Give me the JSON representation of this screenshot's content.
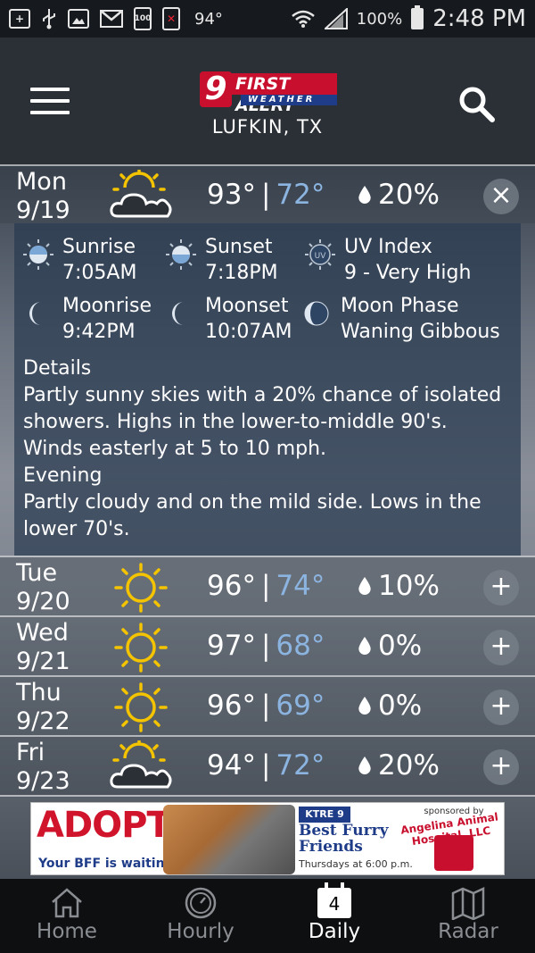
{
  "status_bar": {
    "temperature": "94°",
    "battery": "100%",
    "time": "2:48 PM",
    "notification_icons": [
      "plus-icon",
      "usb-icon",
      "image-icon",
      "gmail-icon",
      "battery-100-icon",
      "close-icon"
    ]
  },
  "header": {
    "logo_number": "9",
    "logo_text": "FIRST ALERT",
    "logo_sub": "WEATHER",
    "location": "LUFKIN, TX"
  },
  "forecast": [
    {
      "day": "Mon",
      "date": "9/19",
      "icon": "partly-cloudy-icon",
      "high": "93°",
      "low": "72°",
      "precip": "20%",
      "toggle": "×"
    },
    {
      "day": "Tue",
      "date": "9/20",
      "icon": "sunny-icon",
      "high": "96°",
      "low": "74°",
      "precip": "10%",
      "toggle": "+"
    },
    {
      "day": "Wed",
      "date": "9/21",
      "icon": "sunny-icon",
      "high": "97°",
      "low": "68°",
      "precip": "0%",
      "toggle": "+"
    },
    {
      "day": "Thu",
      "date": "9/22",
      "icon": "sunny-icon",
      "high": "96°",
      "low": "69°",
      "precip": "0%",
      "toggle": "+"
    },
    {
      "day": "Fri",
      "date": "9/23",
      "icon": "partly-cloudy-icon",
      "high": "94°",
      "low": "72°",
      "precip": "20%",
      "toggle": "+"
    }
  ],
  "details": {
    "sunrise_label": "Sunrise",
    "sunrise_value": "7:05AM",
    "sunset_label": "Sunset",
    "sunset_value": "7:18PM",
    "uv_label": "UV Index",
    "uv_value": "9 - Very High",
    "uv_badge": "UV",
    "moonrise_label": "Moonrise",
    "moonrise_value": "9:42PM",
    "moonset_label": "Moonset",
    "moonset_value": "10:07AM",
    "moonphase_label": "Moon Phase",
    "moonphase_value": "Waning Gibbous",
    "details_heading": "Details",
    "details_text": "Partly sunny skies with a 20% chance of isolated showers.  Highs in the lower-to-middle 90's. Winds easterly at 5 to 10 mph.",
    "evening_heading": "Evening",
    "evening_text": "Partly cloudy and on the mild side.  Lows in the lower 70's."
  },
  "ad": {
    "headline": "ADOPT!",
    "tagline": "Your BFF is waiting.",
    "station": "KTRE 9",
    "show_title": "Best Furry Friends",
    "show_time": "Thursdays at 6:00 p.m.",
    "sponsor_label": "sponsored by",
    "sponsor": "Angelina Animal Hospital, LLC"
  },
  "bottom_nav": {
    "home": "Home",
    "hourly": "Hourly",
    "daily": "Daily",
    "daily_badge": "4",
    "radar": "Radar"
  }
}
